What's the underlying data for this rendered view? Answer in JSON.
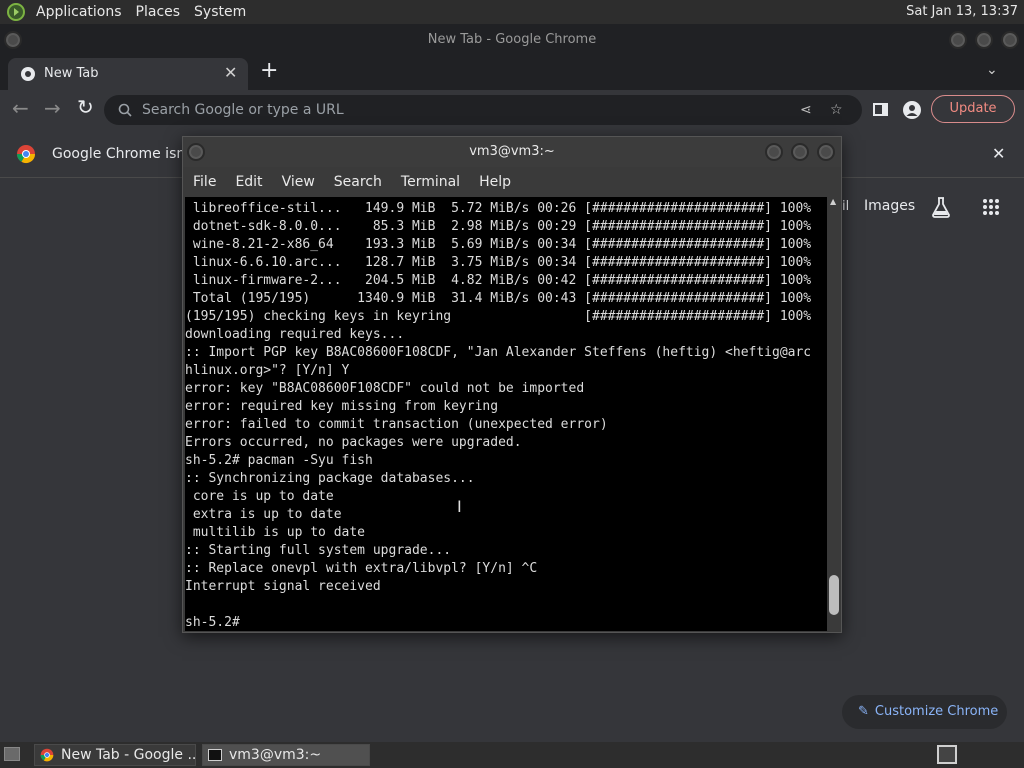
{
  "top_panel": {
    "menus": [
      "Applications",
      "Places",
      "System"
    ],
    "clock": "Sat Jan 13, 13:37"
  },
  "chrome": {
    "window_title": "New Tab - Google Chrome",
    "tab_title": "New Tab",
    "omnibox_placeholder": "Search Google or type a URL",
    "update_label": "Update",
    "infobar_text": "Google Chrome isn't y",
    "ntp_links": {
      "gmail_partial": "il",
      "images": "Images"
    },
    "customize_label": "Customize Chrome"
  },
  "terminal": {
    "title": "vm3@vm3:~",
    "menus": [
      "File",
      "Edit",
      "View",
      "Search",
      "Terminal",
      "Help"
    ],
    "lines": [
      " libreoffice-stil...   149.9 MiB  5.72 MiB/s 00:26 [######################] 100%",
      " dotnet-sdk-8.0.0...    85.3 MiB  2.98 MiB/s 00:29 [######################] 100%",
      " wine-8.21-2-x86_64    193.3 MiB  5.69 MiB/s 00:34 [######################] 100%",
      " linux-6.6.10.arc...   128.7 MiB  3.75 MiB/s 00:34 [######################] 100%",
      " linux-firmware-2...   204.5 MiB  4.82 MiB/s 00:42 [######################] 100%",
      " Total (195/195)      1340.9 MiB  31.4 MiB/s 00:43 [######################] 100%",
      "(195/195) checking keys in keyring                 [######################] 100%",
      "downloading required keys...",
      ":: Import PGP key B8AC08600F108CDF, \"Jan Alexander Steffens (heftig) <heftig@arc",
      "hlinux.org>\"? [Y/n] Y",
      "error: key \"B8AC08600F108CDF\" could not be imported",
      "error: required key missing from keyring",
      "error: failed to commit transaction (unexpected error)",
      "Errors occurred, no packages were upgraded.",
      "sh-5.2# pacman -Syu fish",
      ":: Synchronizing package databases...",
      " core is up to date",
      " extra is up to date",
      " multilib is up to date",
      ":: Starting full system upgrade...",
      ":: Replace onevpl with extra/libvpl? [Y/n] ^C",
      "Interrupt signal received",
      "",
      "sh-5.2# "
    ]
  },
  "taskbar": {
    "items": [
      "New Tab - Google ...",
      "vm3@vm3:~"
    ]
  }
}
